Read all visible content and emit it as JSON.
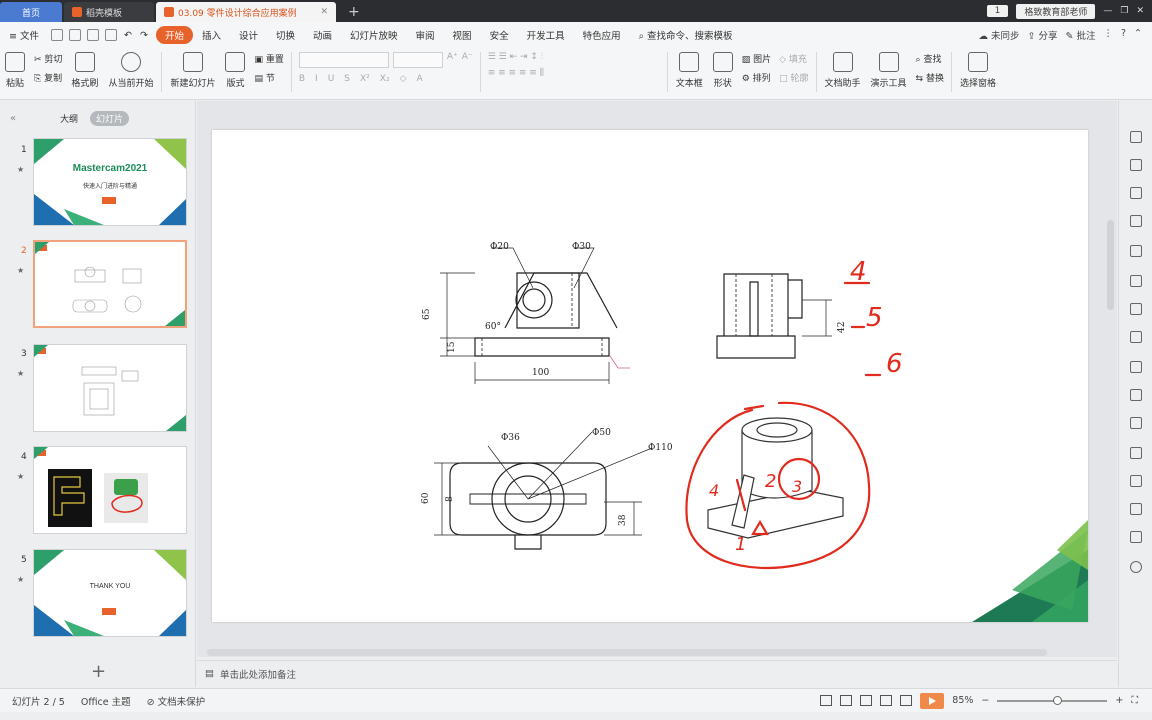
{
  "titlebar": {
    "home_tab": "首页",
    "template_tab": "稻壳模板",
    "doc_tab": "03.09 零件设计综合应用案例",
    "page_badge": "1",
    "user": "格致教育部老师"
  },
  "menu": {
    "file": "文件",
    "items": [
      "开始",
      "插入",
      "设计",
      "切换",
      "动画",
      "幻灯片放映",
      "审阅",
      "视图",
      "安全",
      "开发工具",
      "特色应用"
    ],
    "search": "查找命令、搜索模板",
    "sync": "未同步",
    "share": "分享",
    "comment": "批注"
  },
  "ribbon": {
    "paste": "粘贴",
    "cut": "剪切",
    "copy": "复制",
    "format_painter": "格式刷",
    "from_current": "从当前开始",
    "new_slide": "新建幻灯片",
    "layout": "版式",
    "reset": "重置",
    "section": "节",
    "textbox": "文本框",
    "shape": "形状",
    "picture": "图片",
    "arrange": "排列",
    "fill": "填充",
    "outline": "轮廓",
    "doc_helper": "文档助手",
    "presenter": "演示工具",
    "find": "查找",
    "replace": "替换",
    "select_pane": "选择窗格"
  },
  "pane": {
    "outline_tab": "大纲",
    "slides_tab": "幻灯片",
    "slides": [
      {
        "num": "1",
        "title": "Mastercam2021",
        "subtitle": "快速入门进阶与精通"
      },
      {
        "num": "2"
      },
      {
        "num": "3"
      },
      {
        "num": "4"
      },
      {
        "num": "5",
        "title": "THANK YOU"
      }
    ]
  },
  "drawing": {
    "dims": {
      "phi20": "Φ20",
      "phi30": "Φ30",
      "h65": "65",
      "h15": "15",
      "angle": "60°",
      "w100": "100",
      "h42": "42",
      "phi36": "Φ36",
      "phi50": "Φ50",
      "phi110": "Φ110",
      "d60": "60",
      "d8": "8",
      "d38": "38"
    },
    "handwritten": [
      "4",
      "5",
      "6",
      "1",
      "2",
      "3",
      "4"
    ]
  },
  "notes": {
    "placeholder": "单击此处添加备注"
  },
  "status": {
    "slide_counter": "幻灯片 2 / 5",
    "theme": "Office 主题",
    "protect": "文档未保护",
    "zoom": "85%"
  },
  "colors": {
    "accent": "#e8632c",
    "ink": "#e02b1d",
    "titlebar": "#2b2d30"
  }
}
